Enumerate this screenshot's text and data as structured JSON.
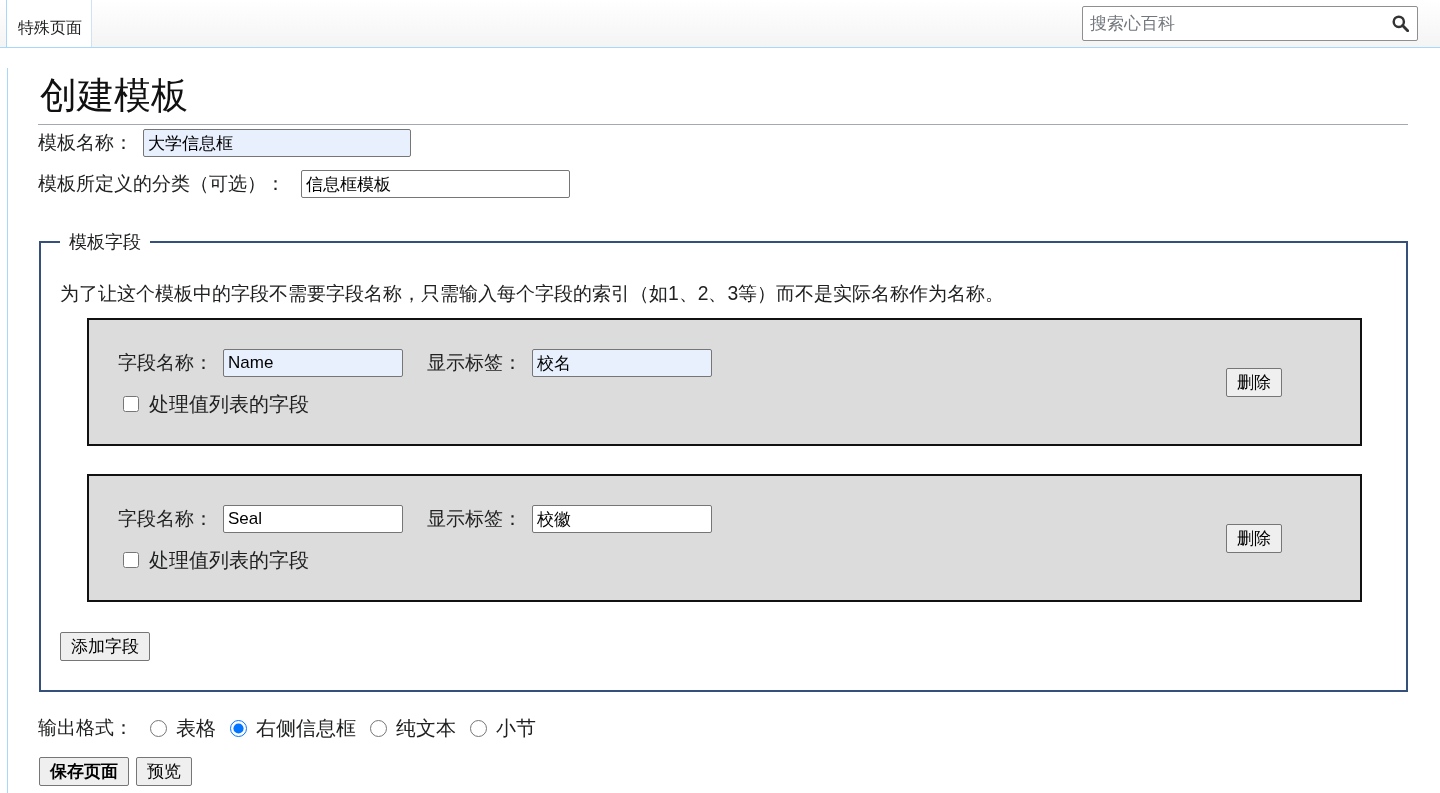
{
  "header": {
    "tabs": [
      {
        "label": "特殊页面",
        "selected": true
      }
    ],
    "search": {
      "placeholder": "搜索心百科"
    }
  },
  "page_title": "创建模板",
  "template_name": {
    "label": "模板名称：",
    "value": "大学信息框",
    "autofilled": true
  },
  "category": {
    "label": "模板所定义的分类（可选）：",
    "value": "信息框模板",
    "autofilled": false
  },
  "fields_section": {
    "legend": "模板字段",
    "description": "为了让这个模板中的字段不需要字段名称，只需输入每个字段的索引（如1、2、3等）而不是实际名称作为名称。",
    "fields": [
      {
        "name": {
          "label": "字段名称：",
          "value": "Name",
          "autofilled": true
        },
        "display": {
          "label": "显示标签：",
          "value": "校名",
          "autofilled": true
        },
        "list_option": {
          "label": "处理值列表的字段",
          "checked": false
        },
        "delete_button": "删除"
      },
      {
        "name": {
          "label": "字段名称：",
          "value": "Seal",
          "autofilled": false
        },
        "display": {
          "label": "显示标签：",
          "value": "校徽",
          "autofilled": false
        },
        "list_option": {
          "label": "处理值列表的字段",
          "checked": false
        },
        "delete_button": "删除"
      }
    ],
    "add_button": "添加字段"
  },
  "output_format": {
    "label": "输出格式：",
    "options": [
      {
        "label": "表格",
        "selected": false
      },
      {
        "label": "右侧信息框",
        "selected": true
      },
      {
        "label": "纯文本",
        "selected": false
      },
      {
        "label": "小节",
        "selected": false
      }
    ]
  },
  "buttons": [
    {
      "label": "保存页面",
      "kind": "primary"
    },
    {
      "label": "预览",
      "kind": "secondary"
    }
  ]
}
